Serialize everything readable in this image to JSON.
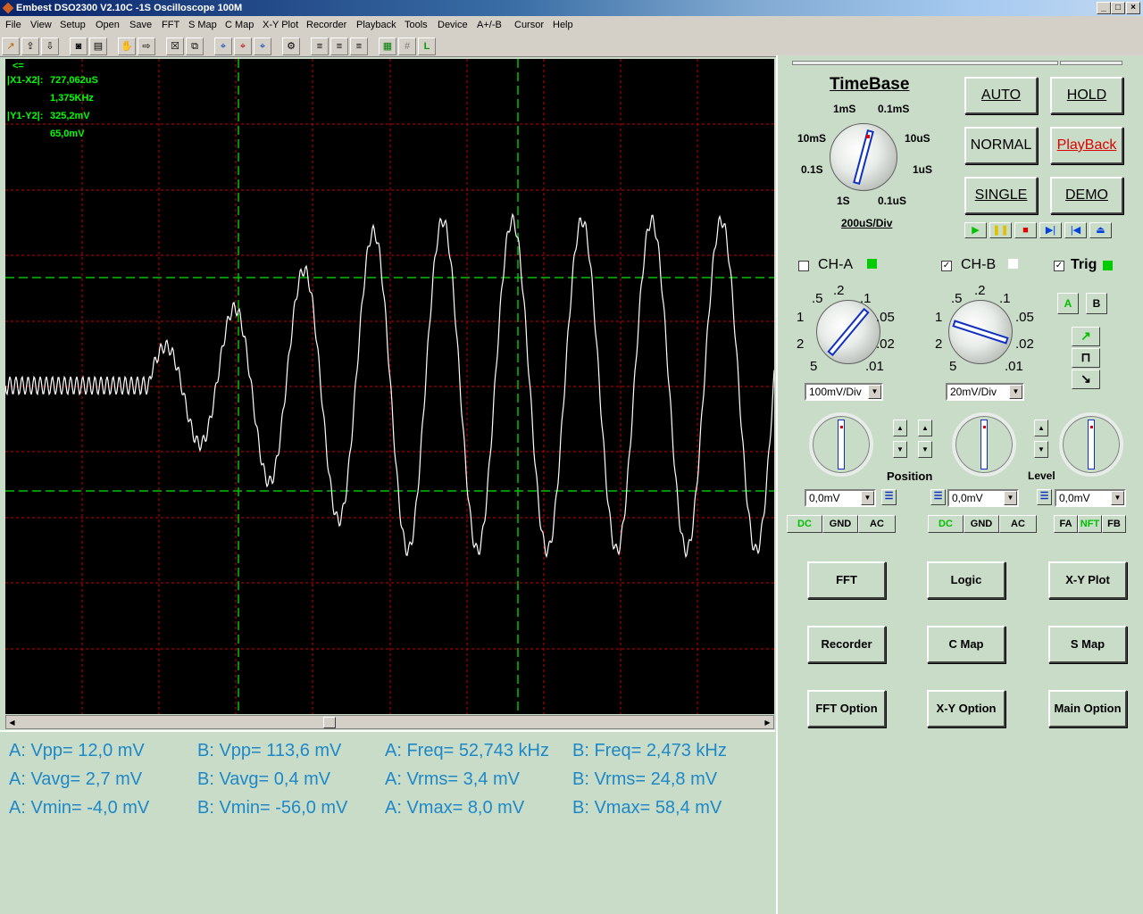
{
  "window": {
    "title": "Embest DSO2300 V2.10C  -1S    Oscilloscope  100M"
  },
  "menu": [
    "File",
    "View",
    "Setup",
    "Open",
    "Save",
    "FFT",
    "S Map",
    "C Map",
    "X-Y Plot",
    "Recorder",
    "Playback",
    "Tools",
    "Device",
    "A+/-B",
    "Cursor",
    "Help"
  ],
  "cursor_readout": {
    "arrow": "<=",
    "x_label": "|X1-X2|:",
    "x_time": "727,062uS",
    "x_freq": "1,375KHz",
    "y_label": "|Y1-Y2|:",
    "y_b": "325,2mV",
    "y_a": "65,0mV"
  },
  "measurements": [
    [
      "A: Vpp= 12,0 mV",
      "B: Vpp= 113,6 mV",
      "A: Freq= 52,743 kHz",
      "B: Freq= 2,473 kHz"
    ],
    [
      "A: Vavg= 2,7 mV",
      "B: Vavg= 0,4 mV",
      "A: Vrms= 3,4 mV",
      "B: Vrms= 24,8 mV"
    ],
    [
      "A: Vmin= -4,0 mV",
      "B: Vmin= -56,0 mV",
      "A: Vmax= 8,0 mV",
      "B: Vmax= 58,4 mV"
    ]
  ],
  "timebase": {
    "title": "TimeBase",
    "value": "200uS/Div",
    "labels": {
      "t1m": "1mS",
      "t01m": "0.1mS",
      "t10m": "10mS",
      "t10u": "10uS",
      "t01s": "0.1S",
      "t1u": "1uS",
      "t1s": "1S",
      "t01u": "0.1uS"
    }
  },
  "mode_buttons": {
    "auto": "AUTO",
    "hold": "HOLD",
    "normal": "NORMAL",
    "playback": "PlayBack",
    "single": "SINGLE",
    "demo": "DEMO"
  },
  "playback_controls": {
    "play": "▶",
    "pause": "❚❚",
    "stop": "■",
    "step_fwd": "▶|",
    "step_back": "|◀",
    "eject": "⏏"
  },
  "channels": {
    "cha": {
      "label": "CH-A",
      "checked": "",
      "volts_div": "100mV/Div",
      "position": "0,0mV"
    },
    "chb": {
      "label": "CH-B",
      "checked": "✓",
      "volts_div": "20mV/Div",
      "position": "0,0mV"
    },
    "trig": {
      "label": "Trig",
      "checked": "✓",
      "level": "0,0mV"
    }
  },
  "volt_labels": {
    "v5": ".5",
    "v2": ".2",
    "v1": ".1",
    "v1x": "1",
    "v05": ".05",
    "v2x": "2",
    "v02": ".02",
    "v5x": "5",
    "v01": ".01"
  },
  "trigger_source": {
    "a": "A",
    "b": "B"
  },
  "trigger_edge": {
    "rise": "↗",
    "pulse": "⊓",
    "fall": "↘"
  },
  "knob_labels": {
    "position": "Position",
    "level": "Level"
  },
  "coupling": {
    "a": {
      "dc": "DC",
      "gnd": "GND",
      "ac": "AC"
    },
    "b": {
      "dc": "DC",
      "gnd": "GND",
      "ac": "AC"
    },
    "t": {
      "fa": "FA",
      "nft": "NFT",
      "fb": "FB"
    }
  },
  "function_buttons": {
    "fft": "FFT",
    "logic": "Logic",
    "xy": "X-Y Plot",
    "recorder": "Recorder",
    "cmap": "C Map",
    "smap": "S Map",
    "fft_opt": "FFT Option",
    "xy_opt": "X-Y Option",
    "main_opt": "Main Option"
  },
  "colors": {
    "grid": "#c80000",
    "cursor": "#00c000",
    "trace": "#ffffff",
    "readout": "#00ff00",
    "measure": "#1e88c8",
    "led_on": "#00cc00"
  }
}
